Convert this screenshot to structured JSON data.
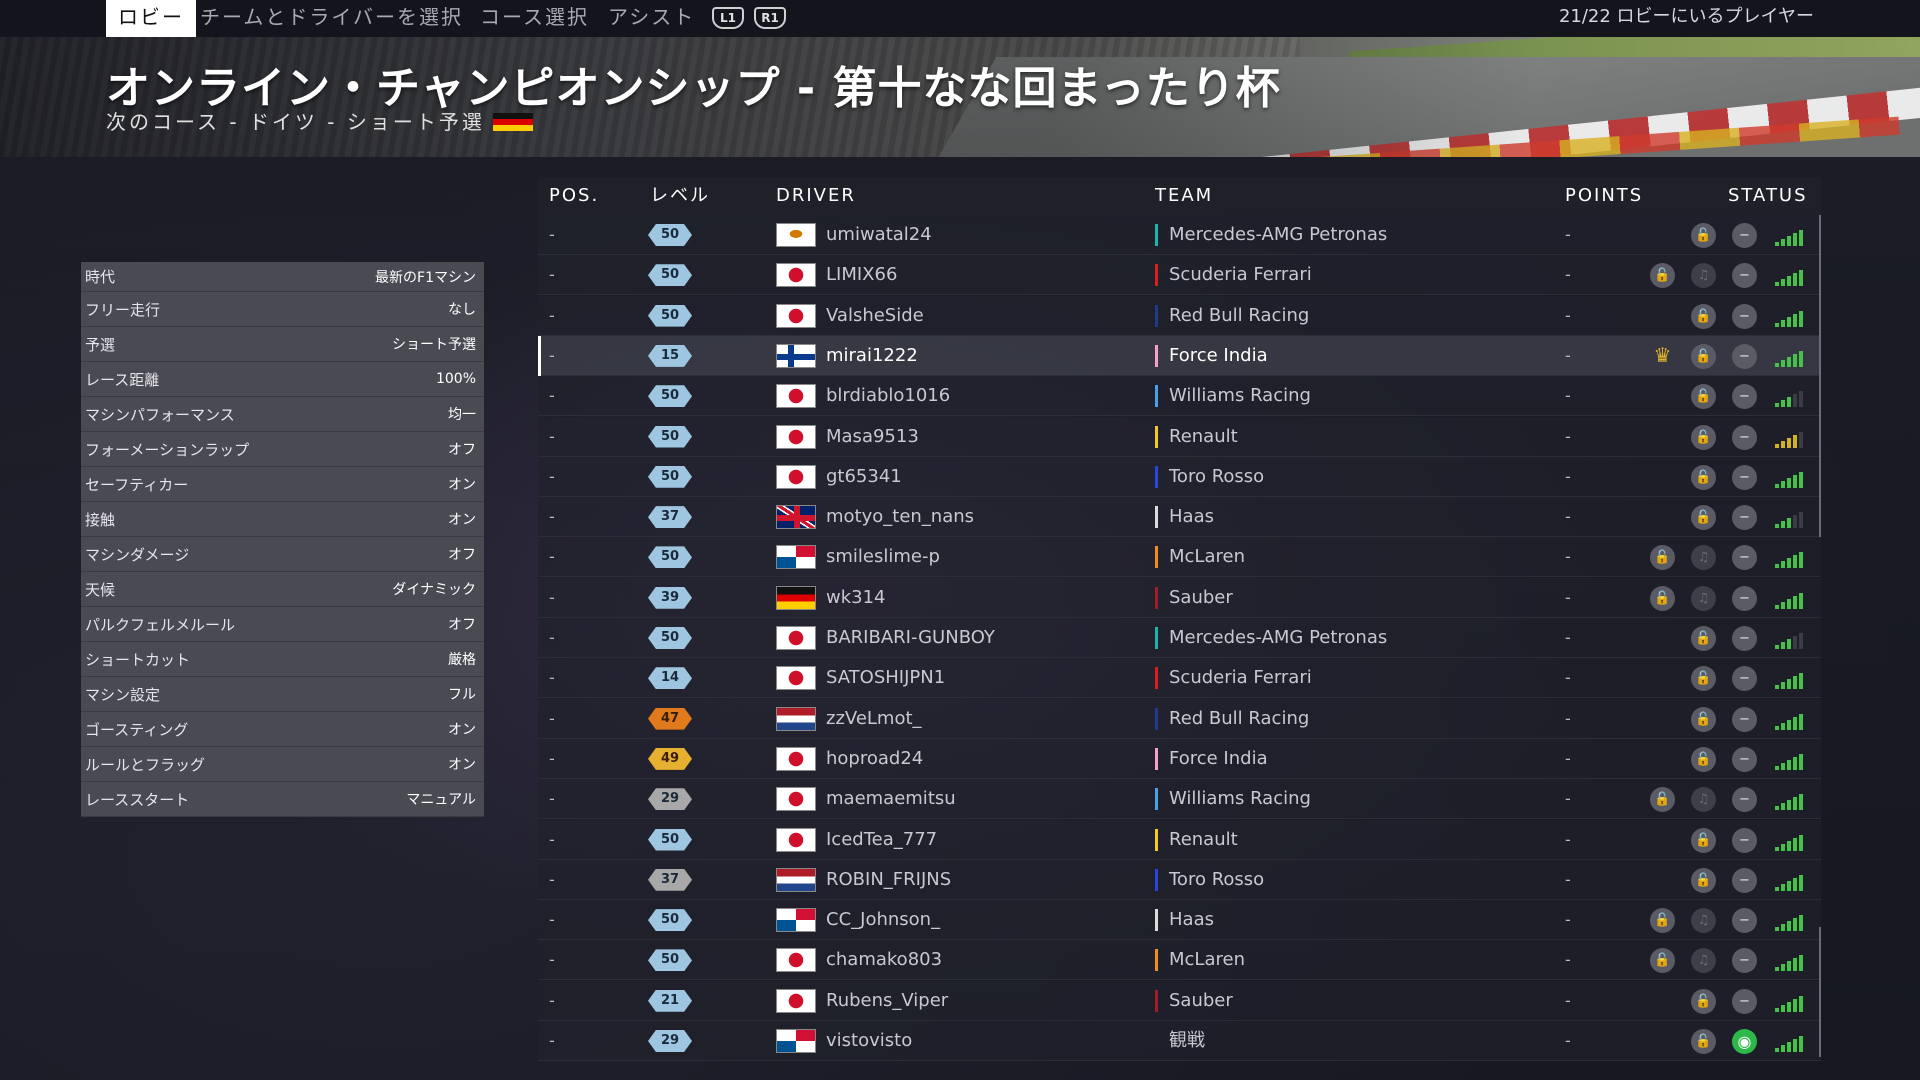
{
  "nav": {
    "tabs": [
      {
        "label": "ロビー",
        "active": true
      },
      {
        "label": "チームとドライバーを選択",
        "active": false
      },
      {
        "label": "コース選択",
        "active": false
      },
      {
        "label": "アシスト",
        "active": false
      }
    ],
    "buttons": [
      "L1",
      "R1"
    ],
    "players_in_lobby": "21/22 ロビーにいるプレイヤー"
  },
  "banner": {
    "title": "オンライン・チャンピオンシップ - 第十なな回まったり杯",
    "subtitle": "次のコース - ドイツ - ショート予選"
  },
  "settings": [
    {
      "label": "時代",
      "value": "最新のF1マシン"
    },
    {
      "label": "フリー走行",
      "value": "なし"
    },
    {
      "label": "予選",
      "value": "ショート予選"
    },
    {
      "label": "レース距離",
      "value": "100%"
    },
    {
      "label": "マシンパフォーマンス",
      "value": "均一"
    },
    {
      "label": "フォーメーションラップ",
      "value": "オフ"
    },
    {
      "label": "セーフティカー",
      "value": "オン"
    },
    {
      "label": "接触",
      "value": "オン"
    },
    {
      "label": "マシンダメージ",
      "value": "オフ"
    },
    {
      "label": "天候",
      "value": "ダイナミック"
    },
    {
      "label": "パルクフェルメルール",
      "value": "オフ"
    },
    {
      "label": "ショートカット",
      "value": "厳格"
    },
    {
      "label": "マシン設定",
      "value": "フル"
    },
    {
      "label": "ゴースティング",
      "value": "オン"
    },
    {
      "label": "ルールとフラッグ",
      "value": "オン"
    },
    {
      "label": "レーススタート",
      "value": "マニュアル"
    }
  ],
  "table": {
    "headers": {
      "pos": "POS.",
      "level": "レベル",
      "driver": "DRIVER",
      "team": "TEAM",
      "points": "POINTS",
      "status": "STATUS"
    },
    "team_colors": {
      "Mercedes-AMG Petronas": "#1fb5a6",
      "Scuderia Ferrari": "#dc1e1e",
      "Red Bull Racing": "#1e3c8c",
      "Force India": "#f5a0c8",
      "Williams Racing": "#4aa0e6",
      "Renault": "#f5c81e",
      "Toro Rosso": "#2846dc",
      "Haas": "#dcdcdc",
      "McLaren": "#f08c1e",
      "Sauber": "#a01e28",
      "観戦": "#000000"
    },
    "badge_colors": {
      "blue": "#9ec6e0",
      "orange": "#e07a1c",
      "gold": "#e8b030",
      "gray": "#a8a8a8"
    },
    "rows": [
      {
        "pos": "-",
        "level": "50",
        "badge": "blue",
        "flag": "cy",
        "driver": "umiwatal24",
        "team": "Mercedes-AMG Petronas",
        "points": "-",
        "mic": false,
        "crown": false,
        "signal": "full"
      },
      {
        "pos": "-",
        "level": "50",
        "badge": "blue",
        "flag": "jp",
        "driver": "LIMIX66",
        "team": "Scuderia Ferrari",
        "points": "-",
        "mic": true,
        "crown": false,
        "signal": "full"
      },
      {
        "pos": "-",
        "level": "50",
        "badge": "blue",
        "flag": "jp",
        "driver": "ValsheSide",
        "team": "Red Bull Racing",
        "points": "-",
        "mic": false,
        "crown": false,
        "signal": "full"
      },
      {
        "pos": "-",
        "level": "15",
        "badge": "blue",
        "flag": "fi",
        "driver": "mirai1222",
        "team": "Force India",
        "points": "-",
        "mic": false,
        "crown": true,
        "signal": "full",
        "highlight": true
      },
      {
        "pos": "-",
        "level": "50",
        "badge": "blue",
        "flag": "jp",
        "driver": "blrdiablo1016",
        "team": "Williams Racing",
        "points": "-",
        "mic": false,
        "crown": false,
        "signal": "weak"
      },
      {
        "pos": "-",
        "level": "50",
        "badge": "blue",
        "flag": "jp",
        "driver": "Masa9513",
        "team": "Renault",
        "points": "-",
        "mic": false,
        "crown": false,
        "signal": "yellow"
      },
      {
        "pos": "-",
        "level": "50",
        "badge": "blue",
        "flag": "jp",
        "driver": "gt65341",
        "team": "Toro Rosso",
        "points": "-",
        "mic": false,
        "crown": false,
        "signal": "full"
      },
      {
        "pos": "-",
        "level": "37",
        "badge": "blue",
        "flag": "gb",
        "driver": "motyo_ten_nans",
        "team": "Haas",
        "points": "-",
        "mic": false,
        "crown": false,
        "signal": "weak"
      },
      {
        "pos": "-",
        "level": "50",
        "badge": "blue",
        "flag": "pa",
        "driver": "smileslime-p",
        "team": "McLaren",
        "points": "-",
        "mic": true,
        "crown": false,
        "signal": "full"
      },
      {
        "pos": "-",
        "level": "39",
        "badge": "blue",
        "flag": "de",
        "driver": "wk314",
        "team": "Sauber",
        "points": "-",
        "mic": true,
        "crown": false,
        "signal": "full"
      },
      {
        "pos": "-",
        "level": "50",
        "badge": "blue",
        "flag": "jp",
        "driver": "BARIBARI-GUNBOY",
        "team": "Mercedes-AMG Petronas",
        "points": "-",
        "mic": false,
        "crown": false,
        "signal": "weak"
      },
      {
        "pos": "-",
        "level": "14",
        "badge": "blue",
        "flag": "jp",
        "driver": "SATOSHIJPN1",
        "team": "Scuderia Ferrari",
        "points": "-",
        "mic": false,
        "crown": false,
        "signal": "full"
      },
      {
        "pos": "-",
        "level": "47",
        "badge": "orange",
        "flag": "nl",
        "driver": "zzVeLmot_",
        "team": "Red Bull Racing",
        "points": "-",
        "mic": false,
        "crown": false,
        "signal": "full"
      },
      {
        "pos": "-",
        "level": "49",
        "badge": "gold",
        "flag": "jp",
        "driver": "hoproad24",
        "team": "Force India",
        "points": "-",
        "mic": false,
        "crown": false,
        "signal": "full"
      },
      {
        "pos": "-",
        "level": "29",
        "badge": "gray",
        "flag": "jp",
        "driver": "maemaemitsu",
        "team": "Williams Racing",
        "points": "-",
        "mic": true,
        "crown": false,
        "signal": "full"
      },
      {
        "pos": "-",
        "level": "50",
        "badge": "blue",
        "flag": "jp",
        "driver": "IcedTea_777",
        "team": "Renault",
        "points": "-",
        "mic": false,
        "crown": false,
        "signal": "full"
      },
      {
        "pos": "-",
        "level": "37",
        "badge": "gray",
        "flag": "nl",
        "driver": "ROBIN_FRIJNS",
        "team": "Toro Rosso",
        "points": "-",
        "mic": false,
        "crown": false,
        "signal": "full"
      },
      {
        "pos": "-",
        "level": "50",
        "badge": "blue",
        "flag": "pa",
        "driver": "CC_Johnson_",
        "team": "Haas",
        "points": "-",
        "mic": true,
        "crown": false,
        "signal": "full"
      },
      {
        "pos": "-",
        "level": "50",
        "badge": "blue",
        "flag": "jp",
        "driver": "chamako803",
        "team": "McLaren",
        "points": "-",
        "mic": true,
        "crown": false,
        "signal": "full"
      },
      {
        "pos": "-",
        "level": "21",
        "badge": "blue",
        "flag": "jp",
        "driver": "Rubens_Viper",
        "team": "Sauber",
        "points": "-",
        "mic": false,
        "crown": false,
        "signal": "full"
      },
      {
        "pos": "-",
        "level": "29",
        "badge": "blue",
        "flag": "pa",
        "driver": "vistovisto",
        "team": "観戦",
        "points": "-",
        "mic": false,
        "crown": false,
        "signal": "full",
        "spectator": true
      }
    ]
  }
}
